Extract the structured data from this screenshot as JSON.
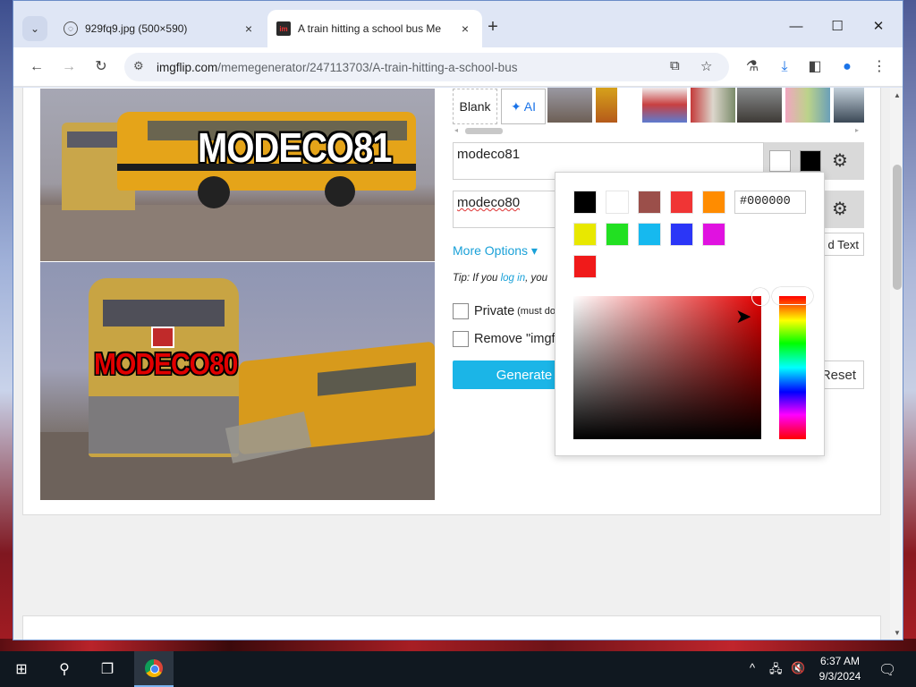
{
  "browser": {
    "tabs": [
      {
        "title": "929fq9.jpg (500×590)",
        "close": "×"
      },
      {
        "title": "A train hitting a school bus Me",
        "close": "×"
      }
    ],
    "new_tab": "+",
    "window_controls": {
      "minimize": "—",
      "maximize": "☐",
      "close": "✕"
    },
    "url_host": "imgflip.com",
    "url_path": "/memegenerator/247113703/A-train-hitting-a-school-bus"
  },
  "meme": {
    "top_caption": "MODECO81",
    "bottom_caption": "MODECO80"
  },
  "templates": {
    "blank_label": "Blank",
    "ai_label": "✦ AI",
    "scroll_left": "◂",
    "scroll_right": "▸"
  },
  "text_boxes": [
    {
      "value": "modeco81",
      "outline_color": "#ffffff",
      "fill_color": "#000000"
    },
    {
      "value": "modeco80"
    }
  ],
  "options": {
    "more_options": "More Options ▾",
    "tip_prefix": "Tip: If you ",
    "tip_link": "log in",
    "tip_suffix": ", you",
    "private_label": "Private",
    "private_note": "(must do",
    "remove_label": "Remove \"imgf",
    "generate_label": "Generate",
    "add_text_label": "d Text",
    "reset_label": "Reset"
  },
  "color_picker": {
    "hex_value": "#000000",
    "palette": [
      "#000000",
      "#ffffff",
      "#9b4f4a",
      "#f03535",
      "#ff8c00",
      "#e8e800",
      "#22e022",
      "#16b9ef",
      "#2b36f7",
      "#e012e0",
      "#f01a1a"
    ],
    "selected_hue": "#e20000"
  },
  "taskbar": {
    "time": "6:37 AM",
    "date": "9/3/2024"
  }
}
